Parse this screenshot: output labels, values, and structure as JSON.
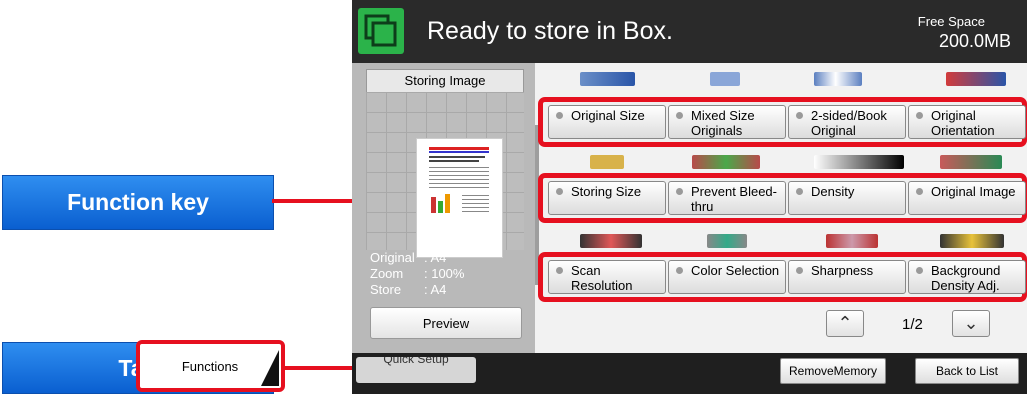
{
  "callouts": {
    "function_key": "Function key",
    "tab": "Tab"
  },
  "header": {
    "title": "Ready to store in Box.",
    "free_space_label": "Free Space",
    "free_space_value": "200.0MB"
  },
  "preview": {
    "title": "Storing Image",
    "info": [
      {
        "key": "Original",
        "value": ": A4"
      },
      {
        "key": "Zoom",
        "value": ": 100%"
      },
      {
        "key": "Store",
        "value": ": A4"
      }
    ],
    "preview_button": "Preview"
  },
  "function_keys": {
    "row1": [
      "Original Size",
      "Mixed Size Originals",
      "2-sided/Book Original",
      "Original Orientation"
    ],
    "row2": [
      "Storing Size",
      "Prevent Bleed-thru",
      "Density",
      "Original Image"
    ],
    "row3": [
      "Scan Resolution",
      "Color Selection",
      "Sharpness",
      "Background Density Adj."
    ]
  },
  "pager": {
    "indicator": "1/2"
  },
  "tabs": {
    "quick_setup": "Quick Setup",
    "functions": "Functions"
  },
  "bottom_buttons": {
    "remove_memory": "RemoveMemory",
    "back_to_list": "Back to List"
  },
  "colors": {
    "accent_red": "#e6101f",
    "callout_blue": "#1a73e8",
    "box_green": "#2bb34a"
  }
}
